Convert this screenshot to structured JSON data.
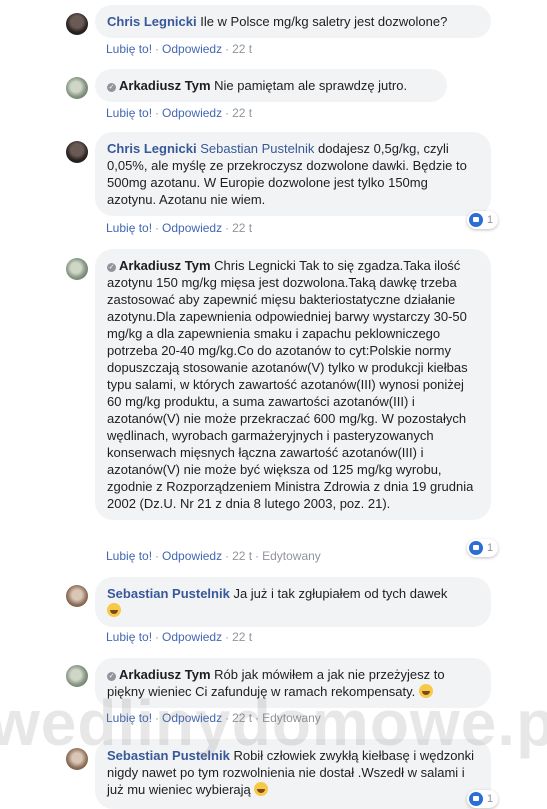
{
  "actions": {
    "like": "Lubię to!",
    "reply": "Odpowiedz",
    "edited": "Edytowany"
  },
  "watermark": "wedlinydomowe.p",
  "comments": [
    {
      "author": "Chris Legnicki",
      "text": "Ile w Polsce mg/kg saletry jest dozwolone?",
      "time": "22 t"
    },
    {
      "author": "Arkadiusz Tym",
      "text": "Nie pamiętam ale sprawdzę jutro.",
      "time": "22 t"
    },
    {
      "author": "Chris Legnicki",
      "mention": "Sebastian Pustelnik",
      "text": "dodajesz 0,5g/kg, czyli 0,05%, ale myślę ze przekroczysz dozwolone dawki. Będzie to 500mg azotanu. W Europie dozwolone jest tylko 150mg azotynu. Azotanu nie wiem.",
      "time": "22 t",
      "likes": "1"
    },
    {
      "author": "Arkadiusz Tym",
      "text": "Chris Legnicki Tak to się zgadza.Taka ilość azotynu 150 mg/kg mięsa jest dozwolona.Taką dawkę trzeba zastosować aby zapewnić mięsu bakteriostatyczne działanie azotynu.Dla zapewnienia odpowiedniej barwy wystarczy 30-50 mg/kg a dla zapewnienia smaku i zapachu peklowniczego potrzeba 20-40 mg/kg.Co do azotanów to cyt:Polskie normy dopuszczają stosowanie azotanów(V) tylko w produkcji kiełbas typu salami, w których zawartość azotanów(III) wynosi poniżej 60 mg/kg produktu, a suma zawartości azotanów(III) i azotanów(V) nie może przekraczać 600 mg/kg. W pozostałych wędlinach, wyrobach garmażeryjnych i pasteryzowanych konserwach mięsnych łączna zawartość azotanów(III) i azotanów(V) nie może być większa od 125 mg/kg wyrobu, zgodnie z Rozporządzeniem Ministra Zdrowia z dnia 19 grudnia 2002 (Dz.U. Nr 21 z dnia 8 lutego 2003, poz. 21).",
      "time": "22 t",
      "likes": "1"
    },
    {
      "author": "Sebastian Pustelnik",
      "text": "Ja już i tak zgłupiałem od tych dawek",
      "time": "22 t"
    },
    {
      "author": "Arkadiusz Tym",
      "text": "Rób jak mówiłem a jak nie przeżyjesz to piękny wieniec Ci zafunduję w ramach rekompensaty.",
      "time": "22 t"
    },
    {
      "author": "Sebastian Pustelnik",
      "text": "Robił człowiek zwykłą kiełbasę i wędzonki nigdy nawet po tym rozwolnienia nie dostał .Wszedł w salami i już mu wieniec wybierają",
      "likes": "1"
    }
  ]
}
